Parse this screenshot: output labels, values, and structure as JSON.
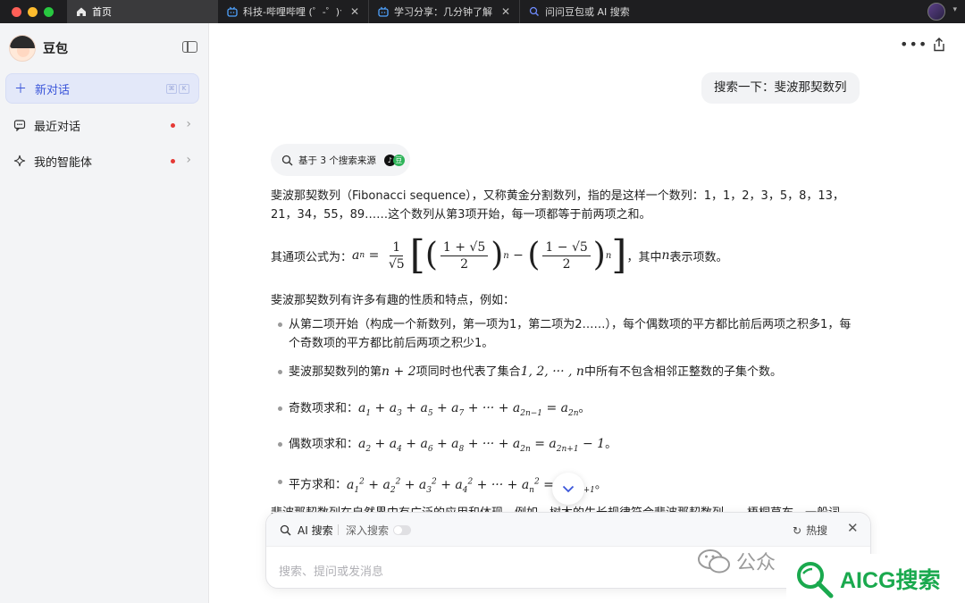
{
  "tabs": [
    {
      "label": "首页",
      "icon": "home-icon",
      "active": true
    },
    {
      "label": "科技-哔哩哔哩 (゜-゜)つ",
      "icon": "bilibili-icon"
    },
    {
      "label": "学习分享：几分钟了解",
      "icon": "bilibili-icon"
    },
    {
      "label": "问问豆包或 AI 搜索",
      "icon": "ai-search-icon"
    }
  ],
  "sidebar": {
    "brand": "豆包",
    "items": [
      {
        "label": "新对话",
        "icon": "plus-icon",
        "shortcut": [
          "⌘",
          "K"
        ]
      },
      {
        "label": "最近对话",
        "icon": "chat-bubble-icon"
      },
      {
        "label": "我的智能体",
        "icon": "sparkle-icon"
      }
    ]
  },
  "chat": {
    "user_message": "搜索一下：斐波那契数列",
    "source_pill": "基于 3 个搜索来源",
    "p1": "斐波那契数列（Fibonacci sequence），又称黄金分割数列，指的是这样一个数列：1，1，2，3，5，8，13，21，34，55，89……这个数列从第3项开始，每一项都等于前两项之和。",
    "formula_prefix": "其通项公式为：",
    "formula_suffix": "，其中",
    "formula_suffix_var": "n",
    "formula_suffix_end": "表示项数。",
    "p2": "斐波那契数列有许多有趣的性质和特点，例如：",
    "li1": "从第二项开始（构成一个新数列，第一项为1，第二项为2……），每个偶数项的平方都比前后两项之积多1，每个奇数项的平方都比前后两项之积少1。",
    "li2_a": "斐波那契数列的第",
    "li2_math": "n + 2",
    "li2_b": "项同时也代表了集合",
    "li2_set": "1, 2, ··· , n",
    "li2_c": "中所有不包含相邻正整数的子集个数。",
    "li3_label": "奇数项求和：",
    "li4_label": "偶数项求和：",
    "li5_label": "平方求和：",
    "cut_line": "斐波那契数列在自然界中有广泛的应用和体现，例如，树木的生长规律符合斐波那契数列……梧桐草布，一般词"
  },
  "input": {
    "ai_search": "AI 搜索",
    "deep_search": "深入搜索",
    "hot": "热搜",
    "placeholder": "搜索、提问或发消息"
  },
  "watermark": {
    "left": "公众",
    "right": "AICG搜索"
  }
}
